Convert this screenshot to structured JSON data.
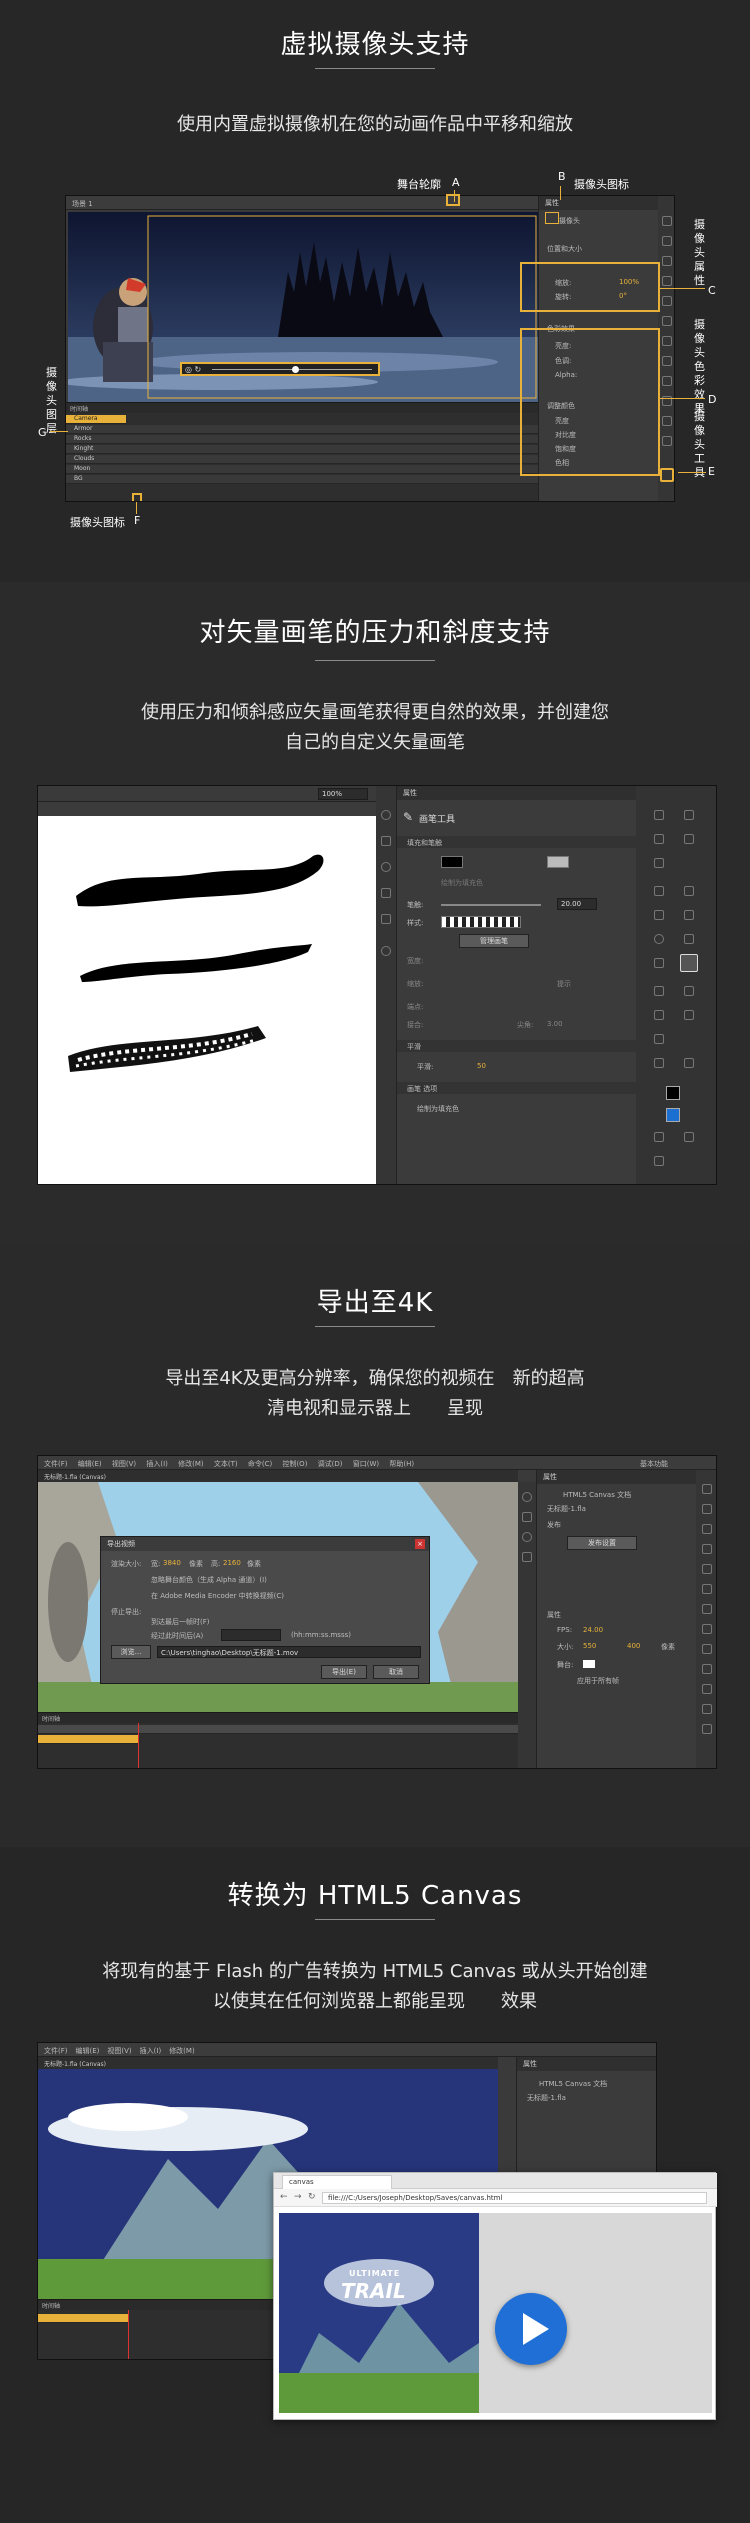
{
  "section1": {
    "title": "虚拟摄像头支持",
    "subtitle": "使用内置虚拟摄像机在您的动画作品中平移和缩放",
    "callouts": {
      "stage_outline": "舞台轮廓",
      "a": "A",
      "b": "B",
      "camera_icon_label": "摄像头图标",
      "camera_props": "摄像头属性",
      "c": "C",
      "camera_color": "摄像头色彩效果",
      "d": "D",
      "camera_tool": "摄像头工具",
      "e": "E",
      "camera_layer": "摄像头图层",
      "g": "G",
      "camera_icon_bottom": "摄像头图标",
      "f": "F"
    },
    "ui": {
      "tab": "场景 1",
      "layers": [
        "Camera",
        "Armor",
        "Rocks",
        "Kinght",
        "Clouds",
        "Moon",
        "BG"
      ],
      "prop_title": "摄像头",
      "prop_rows": [
        "位置和大小",
        "缩放:",
        "旋转:",
        "色彩效果",
        "亮度:",
        "色调:",
        "Alpha:",
        "调整颜色",
        "亮度",
        "对比度",
        "饱和度",
        "色相"
      ],
      "zoom_value": "100%",
      "rotate_value": "0°"
    }
  },
  "section2": {
    "title": "对矢量画笔的压力和斜度支持",
    "subtitle_line1": "使用压力和倾斜感应矢量画笔获得更自然的效果，并创建您",
    "subtitle_line2": "自己的自定义矢量画笔",
    "ui": {
      "zoom": "100%",
      "panel_tab": "属性",
      "tool_name": "画笔工具",
      "fill_stroke": "填充和笔触",
      "object_draw": "绘制为填充色",
      "stroke_label": "笔触:",
      "stroke_value": "20.00",
      "style_label": "样式:",
      "manage_btn": "管理画笔",
      "width_label": "宽度:",
      "scale_label": "缩放:",
      "hint_label": "提示",
      "cap_label": "端点:",
      "join_label": "接合:",
      "miter_label": "尖角:",
      "miter_value": "3.00",
      "smooth_section": "平滑",
      "smooth_label": "平滑:",
      "smooth_value": "50",
      "brush_opts": "画笔 选项",
      "draw_fill": "绘制为填充色"
    }
  },
  "section3": {
    "title": "导出至4K",
    "subtitle_line1": "导出至4K及更高分辨率，确保您的视频在　新的超高",
    "subtitle_line2": "清电视和显示器上　　呈现",
    "ui": {
      "menu": [
        "文件(F)",
        "编辑(E)",
        "视图(V)",
        "插入(I)",
        "修改(M)",
        "文本(T)",
        "命令(C)",
        "控制(O)",
        "调试(D)",
        "窗口(W)",
        "帮助(H)"
      ],
      "file_tab": "无标题-1.fla (Canvas)",
      "workspace": "基本功能",
      "dialog_title": "导出视频",
      "render_size": "渲染大小:",
      "w_label": "宽:",
      "w_value": "3840",
      "h_label": "高:",
      "h_value": "2160",
      "unit": "像素",
      "ignore_stage": "忽略舞台颜色（生成 Alpha 通道）(I)",
      "encoder": "在 Adobe Media Encoder 中转换视频(C)",
      "stop_export": "停止导出:",
      "opt1": "到达最后一帧时(F)",
      "opt2": "经过此时间后(A)",
      "time_fmt": "(hh:mm:ss.msss)",
      "browse_btn": "浏览...",
      "path": "C:\\Users\\tinghao\\Desktop\\无标题-1.mov",
      "export_btn": "导出(E)",
      "cancel_btn": "取消",
      "doc_title": "HTML5 Canvas 文档",
      "doc_name": "无标题-1.fla",
      "publish": "发布",
      "pub_settings": "发布设置",
      "props": "属性",
      "fps_label": "FPS:",
      "fps_value": "24.00",
      "size_label": "大小:",
      "size_w": "550",
      "size_h": "400",
      "size_unit": "像素",
      "stage_label": "舞台:",
      "apply_frame": "应用于所有帧"
    }
  },
  "section4": {
    "title": "转换为 HTML5 Canvas",
    "subtitle_line1": "将现有的基于 Flash 的广告转换为 HTML5 Canvas 或从头开始创建",
    "subtitle_line2": "以使其在任何浏览器上都能呈现　　效果",
    "ui": {
      "file_tab": "无标题-1.fla (Canvas)",
      "browser_tab": "canvas",
      "url": "file:///C:/Users/Joseph/Desktop/Saves/canvas.html",
      "logo_line1": "ULTIMATE",
      "logo_line2": "TRAIL",
      "doc_title": "HTML5 Canvas 文档",
      "doc_name": "无标题-1.fla"
    }
  },
  "colors": {
    "accent": "#e8b23a",
    "play_button": "#1f6fd6"
  },
  "icons": [
    "play-icon",
    "refresh-icon",
    "back-icon",
    "forward-icon",
    "camera-icon"
  ]
}
